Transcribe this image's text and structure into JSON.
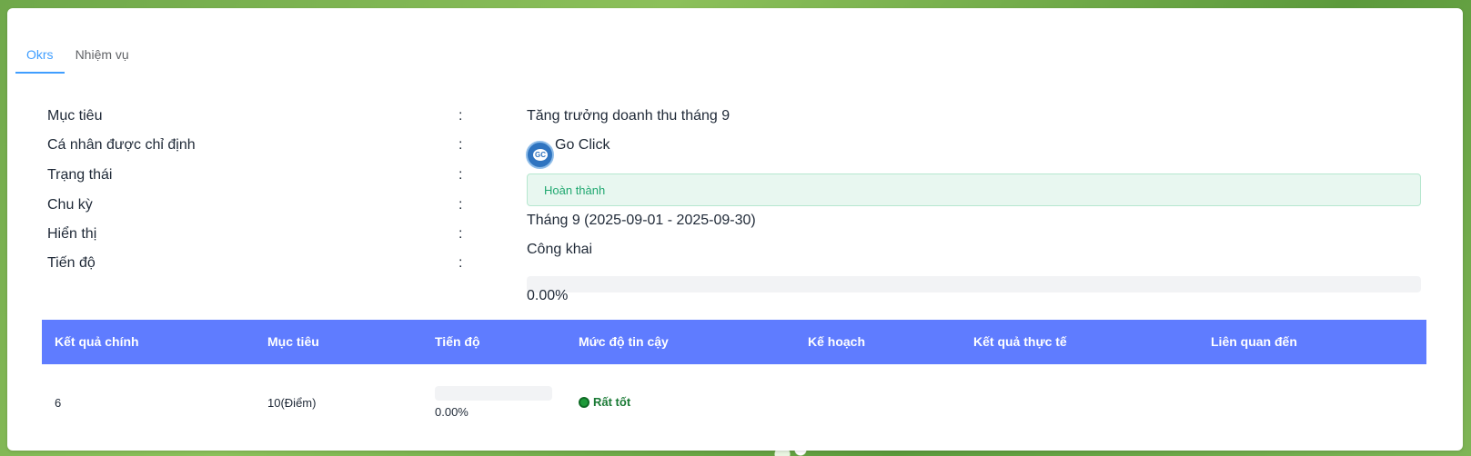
{
  "tabs": [
    {
      "label": "Okrs",
      "active": true
    },
    {
      "label": "Nhiệm vụ",
      "active": false
    }
  ],
  "details": {
    "objective": {
      "label": "Mục tiêu",
      "value": "Tăng trưởng doanh thu tháng 9"
    },
    "assignee": {
      "label": "Cá nhân được chỉ định",
      "value": "Go Click",
      "avatar_text": "GC"
    },
    "status": {
      "label": "Trạng thái",
      "value": "Hoàn thành"
    },
    "cycle": {
      "label": "Chu kỳ",
      "value": "Tháng 9 (2025-09-01 - 2025-09-30)"
    },
    "visibility": {
      "label": "Hiển thị",
      "value": "Công khai"
    },
    "progress": {
      "label": "Tiến độ",
      "value": "0.00%",
      "fraction": 0.0
    },
    "colon": ":"
  },
  "table": {
    "headers": [
      "Kết quả chính",
      "Mục tiêu",
      "Tiến độ",
      "Mức độ tin cậy",
      "Kế hoạch",
      "Kết quả thực tế",
      "Liên quan đến"
    ],
    "rows": [
      {
        "key_result": "6",
        "target": "10(Điểm)",
        "progress": "0.00%",
        "progress_fraction": 0.0,
        "confidence": "Rất tốt",
        "plan": "",
        "actual": "",
        "related": ""
      }
    ]
  },
  "colors": {
    "accent": "#409eff",
    "header_bg": "#5f7cff",
    "status_bg": "#e8f7f0",
    "status_text": "#20a870",
    "confidence_dot": "#1e9a3a"
  }
}
